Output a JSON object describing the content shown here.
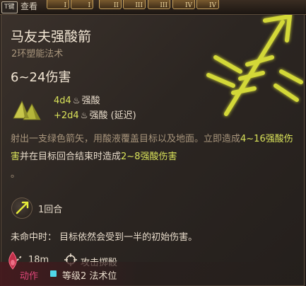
{
  "topbar": {
    "key_hint": "T键",
    "examine_label": "查看",
    "slots": [
      "I",
      "I",
      "II",
      "III",
      "III",
      "IV",
      "IV"
    ]
  },
  "spell": {
    "name": "马友夫强酸箭",
    "subtitle": "2环塑能法术",
    "damage_total": "6~24伤害",
    "damage_lines": [
      {
        "dice": "4d4",
        "type": "强酸",
        "suffix": ""
      },
      {
        "dice": "+2d4",
        "type": "强酸",
        "suffix": " (延迟)"
      }
    ],
    "description": {
      "part1": "射出一支绿色箭矢，用酸液覆盖目标以及地面。立即造成",
      "immediate_damage": "4~16强酸伤害",
      "part2": "并在目标回合结束时造成",
      "delayed_damage": "2~8强酸伤害",
      "part3": "。"
    },
    "cost": "1回合",
    "on_miss": "未命中时：  目标依然会受到一半的初始伤害。",
    "range": "18m",
    "attack": "攻击掷骰",
    "action": "动作",
    "spell_slot": "等级2 法术位"
  },
  "colors": {
    "highlight": "#d9e25a",
    "muted": "#a8957c",
    "action": "#e0477a",
    "slot": "#4fd6e8"
  },
  "icons": {
    "art": "acid-arrow-spell-art",
    "damage": "acid-damage-icon",
    "acid_drop": "acid-drop-icon",
    "round": "acid-arrow-round-icon",
    "range": "range-icon",
    "attack": "crosshair-icon",
    "action": "action-icon",
    "spell_slot": "spell-slot-icon"
  }
}
